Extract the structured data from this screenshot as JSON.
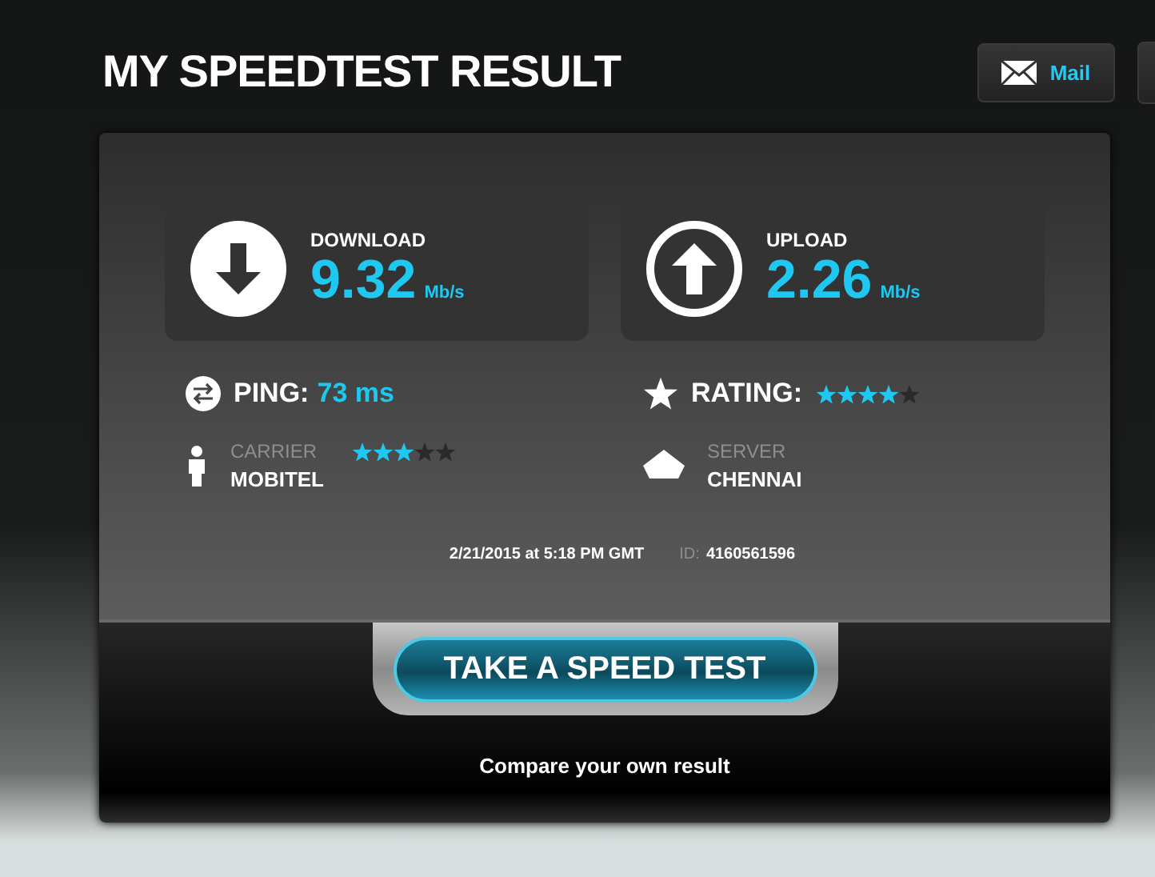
{
  "header": {
    "title": "MY SPEEDTEST RESULT",
    "mail_button": "Mail"
  },
  "results": [
    {
      "kind": "download",
      "label": "DOWNLOAD",
      "value": "9.32",
      "unit": "Mb/s"
    },
    {
      "kind": "upload",
      "label": "UPLOAD",
      "value": "2.26",
      "unit": "Mb/s"
    }
  ],
  "ping": {
    "label": "PING:",
    "value": "73 ms"
  },
  "rating": {
    "label": "RATING:",
    "stars": 4
  },
  "carrier": {
    "label": "CARRIER",
    "name": "MOBITEL",
    "stars": 3
  },
  "server": {
    "label": "SERVER",
    "name": "CHENNAI"
  },
  "timestamp": "2/21/2015 at 5:18 PM GMT",
  "id": {
    "label": "ID:",
    "value": "4160561596"
  },
  "action": {
    "button": "TAKE A SPEED TEST",
    "caption": "Compare your own result"
  }
}
